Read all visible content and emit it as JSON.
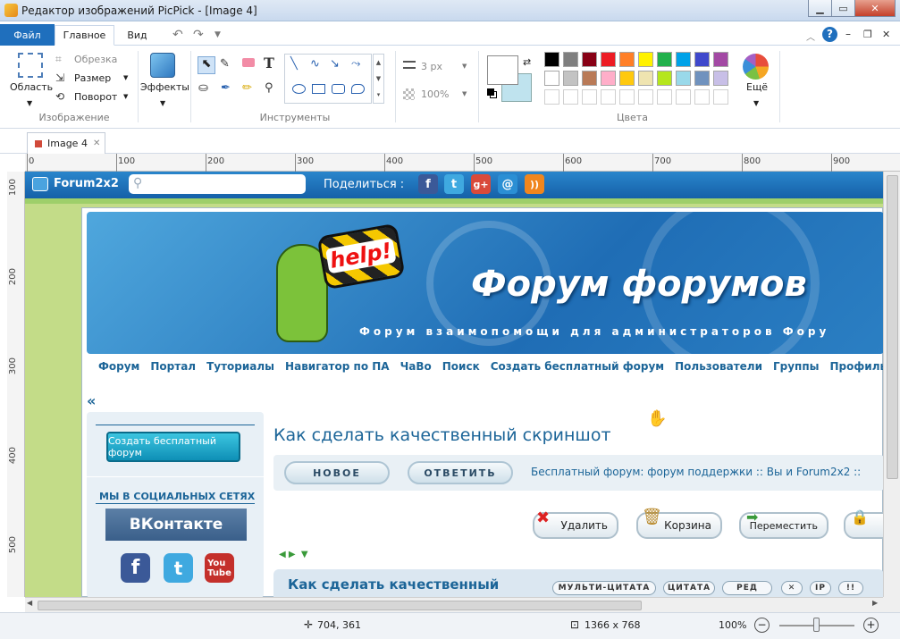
{
  "window": {
    "title": "Редактор изображений PicPick - [Image 4]"
  },
  "tabs": {
    "file": "Файл",
    "home": "Главное",
    "view": "Вид"
  },
  "ribbon": {
    "image_group": {
      "label": "Изображение",
      "area": "Область",
      "crop": "Обрезка",
      "resize": "Размер",
      "rotate": "Поворот"
    },
    "effects": "Эффекты",
    "tools_label": "Инструменты",
    "text_tool": "T",
    "stroke_width": "3 px",
    "opacity": "100%",
    "colors_label": "Цвета",
    "more": "Ещё",
    "palette": [
      "#000000",
      "#7f7f7f",
      "#880015",
      "#ed1c24",
      "#ff7f27",
      "#fff200",
      "#22b14c",
      "#00a2e8",
      "#3f48cc",
      "#a349a4",
      "#ffffff",
      "#c3c3c3",
      "#b97a57",
      "#ffaec9",
      "#ffc90e",
      "#efe4b0",
      "#b5e61d",
      "#99d9ea",
      "#7092be",
      "#c8bfe7"
    ],
    "primary_color": "#ffffff",
    "secondary_color": "#bfe3ee"
  },
  "doc_tab": {
    "name": "Image 4",
    "close": "✕"
  },
  "ruler": {
    "h": [
      "0",
      "100",
      "200",
      "300",
      "400",
      "500",
      "600",
      "700",
      "800",
      "900"
    ],
    "v": [
      "100",
      "200",
      "300",
      "400",
      "500"
    ]
  },
  "forum": {
    "logo": "Forum2x2",
    "share": "Поделиться :",
    "banner_title": "Форум форумов",
    "banner_sub": "Форум взаимопомощи для администраторов Фору",
    "help": "help!",
    "nav": [
      "Форум",
      "Портал",
      "Туториалы",
      "Навигатор по ПА",
      "ЧаВо",
      "Поиск",
      "Создать бесплатный форум",
      "Пользователи",
      "Группы",
      "Профиль"
    ],
    "collapse": "«",
    "create_btn": "Создать бесплатный форум",
    "social_title": "МЫ В СОЦИАЛЬНЫХ СЕТЯХ",
    "vk": "ВКонтакте",
    "topic_title": "Как сделать качественный скриншот",
    "new_btn": "НОВОЕ",
    "reply_btn": "ОТВЕТИТЬ",
    "breadcrumb": "Бесплатный форум: форум поддержки :: Вы и Forum2x2 ::",
    "delete": "Удалить",
    "trash": "Корзина",
    "move": "Переместить",
    "post_title": "Как сделать качественный",
    "multiquote": "МУЛЬТИ-ЦИТАТА",
    "quote": "ЦИТАТА",
    "edit": "РЕД",
    "ip": "IP"
  },
  "status": {
    "cursor": "704, 361",
    "size": "1366 x 768",
    "zoom": "100%"
  }
}
